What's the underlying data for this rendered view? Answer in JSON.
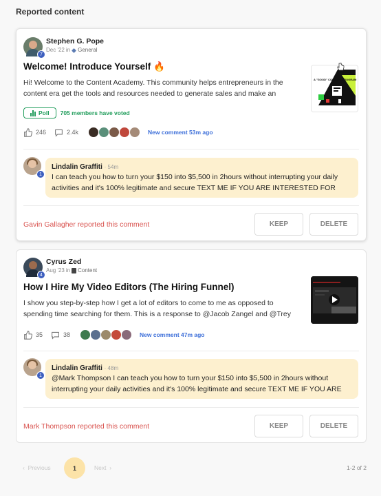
{
  "section_title": "Reported content",
  "posts": [
    {
      "author": "Stephen G. Pope",
      "author_level": "7",
      "date": "Dec '22",
      "in_word": "in",
      "category": "General",
      "title": "Welcome! Introduce Yourself 🔥",
      "excerpt": "Hi! Welcome to the Content Academy. This community helps entrepreneurs in the content era get the tools and resources needed to generate sales and make an",
      "thumbnail_title": "A \"GOOD\" CONTENT PROGRAM",
      "poll_label": "Poll",
      "poll_votes": "705 members have voted",
      "likes": "246",
      "comments": "2.4k",
      "new_comment": "New comment 53m ago",
      "comment": {
        "author": "Lindalin Graffiti",
        "author_level": "1",
        "time": "· 54m",
        "text": "I can teach you how to turn your $150 into $5,500 in 2hours without interrupting your daily activities and it's 100% legitimate and secure TEXT ME IF YOU ARE INTERESTED FOR MORE"
      },
      "reported_by": "Gavin Gallagher reported this comment",
      "keep_label": "KEEP",
      "delete_label": "DELETE"
    },
    {
      "author": "Cyrus Zed",
      "author_level": "4",
      "date": "Aug '23",
      "in_word": "in",
      "category": "Content",
      "title": "How I Hire My Video Editors (The Hiring Funnel)",
      "excerpt": "I show you step-by-step how I get a lot of editors to come to me as opposed to spending time searching for them. This is a response to @Jacob Zangel and @Trey",
      "likes": "35",
      "comments": "38",
      "new_comment": "New comment 47m ago",
      "comment": {
        "author": "Lindalin Graffiti",
        "author_level": "1",
        "time": "· 48m",
        "text": "@Mark Thompson I can teach you how to turn your $150 into $5,500 in 2hours without interrupting your daily activities and it's 100% legitimate and secure TEXT ME IF YOU ARE"
      },
      "reported_by": "Mark Thompson reported this comment",
      "keep_label": "KEEP",
      "delete_label": "DELETE"
    }
  ],
  "pagination": {
    "previous": "Previous",
    "next": "Next",
    "current_page": "1",
    "range": "1-2 of 2"
  },
  "colors": {
    "report_red": "#d9534f",
    "poll_green": "#1f9c5a",
    "link_blue": "#3d6fd9",
    "comment_bubble": "#fdf0cf",
    "page_highlight": "#fce3a8"
  }
}
